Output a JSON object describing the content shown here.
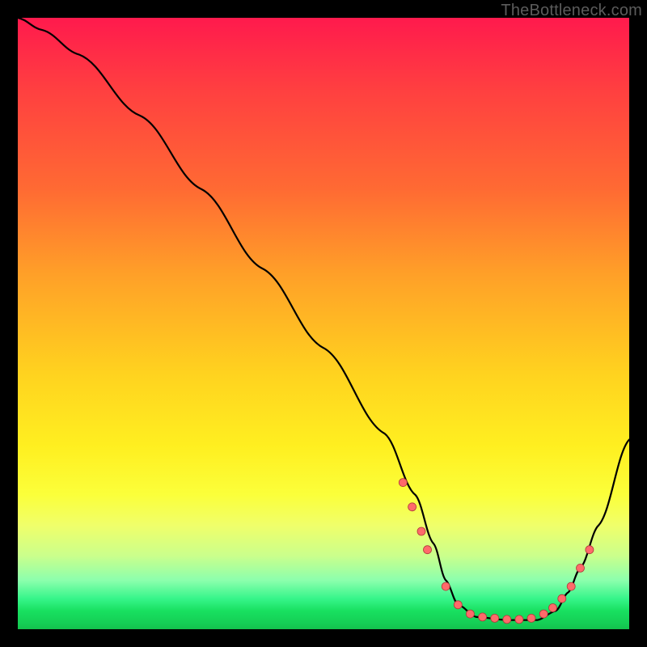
{
  "watermark": "TheBottleneck.com",
  "colors": {
    "gradient_top": "#ff1a4d",
    "gradient_mid": "#ffd21f",
    "gradient_bottom": "#13c24d",
    "curve": "#000000",
    "marker_fill": "#ff6a6a",
    "marker_stroke": "#b03a3a"
  },
  "chart_data": {
    "type": "line",
    "title": "",
    "xlabel": "",
    "ylabel": "",
    "xlim": [
      0,
      100
    ],
    "ylim": [
      0,
      100
    ],
    "grid": false,
    "legend": false,
    "series": [
      {
        "name": "curve",
        "x": [
          0,
          4,
          10,
          20,
          30,
          40,
          50,
          60,
          65,
          68,
          70,
          72,
          75,
          80,
          85,
          88,
          90,
          92,
          95,
          100
        ],
        "y": [
          100,
          98,
          94,
          84,
          72,
          59,
          46,
          32,
          22,
          14,
          8,
          4,
          2,
          1.5,
          1.5,
          3,
          6,
          10,
          17,
          31
        ]
      }
    ],
    "markers": {
      "name": "highlight-points",
      "x": [
        63,
        64.5,
        66,
        67,
        70,
        72,
        74,
        76,
        78,
        80,
        82,
        84,
        86,
        87.5,
        89,
        90.5,
        92,
        93.5
      ],
      "y": [
        24,
        20,
        16,
        13,
        7,
        4,
        2.5,
        2,
        1.8,
        1.6,
        1.6,
        1.8,
        2.5,
        3.5,
        5,
        7,
        10,
        13
      ]
    }
  }
}
